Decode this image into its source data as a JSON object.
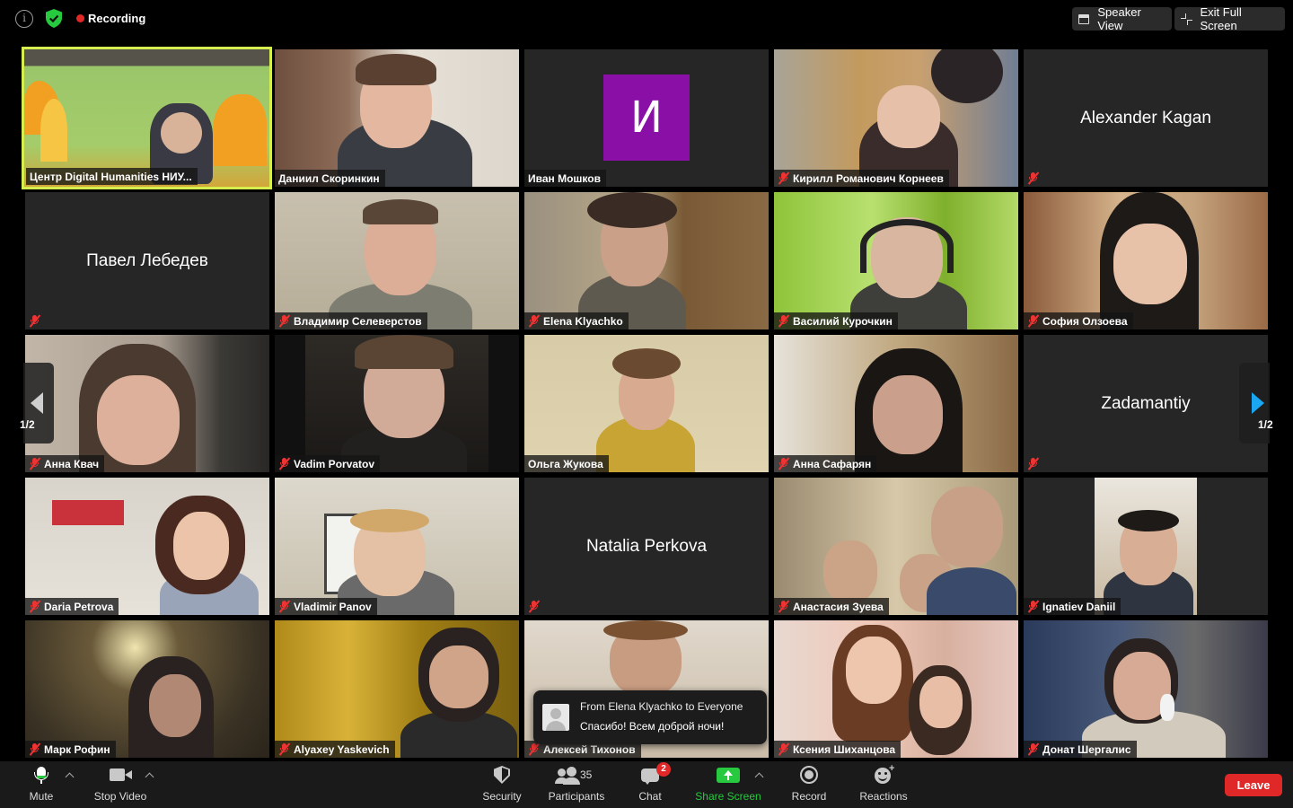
{
  "topbar": {
    "info_icon": "i",
    "recording_label": "Recording",
    "speaker_view_label": "Speaker View",
    "exit_full_screen_label": "Exit Full Screen"
  },
  "colors": {
    "active_speaker_border": "#d7ef4e",
    "muted_red": "#e33333",
    "share_green": "#27c93f",
    "leave_red": "#e02828",
    "avatar_purple": "#8a0fa6",
    "page_arrow_blue": "#1aa6f0"
  },
  "tiles": [
    {
      "name": "Центр Digital Humanities НИУ...",
      "type": "video",
      "muted": false,
      "active": true
    },
    {
      "name": "Даниил Скоринкин",
      "type": "video",
      "muted": false
    },
    {
      "name": "Иван Мошков",
      "type": "avatar",
      "initial": "И",
      "muted": false
    },
    {
      "name": "Кирилл Романович Корнеев",
      "type": "video",
      "muted": true
    },
    {
      "name": "Alexander Kagan",
      "type": "name",
      "muted": true
    },
    {
      "name": "Павел Лебедев",
      "type": "name",
      "muted": true
    },
    {
      "name": "Владимир Селеверстов",
      "type": "video",
      "muted": true
    },
    {
      "name": "Elena Klyachko",
      "type": "video",
      "muted": true
    },
    {
      "name": "Василий Курочкин",
      "type": "video",
      "muted": true
    },
    {
      "name": "София Олзоева",
      "type": "video",
      "muted": true
    },
    {
      "name": "Анна Квач",
      "type": "video",
      "muted": true
    },
    {
      "name": "Vadim Porvatov",
      "type": "video",
      "muted": true
    },
    {
      "name": "Ольга Жукова",
      "type": "video",
      "muted": false
    },
    {
      "name": "Анна Сафарян",
      "type": "video",
      "muted": true
    },
    {
      "name": "Zadamantiy",
      "type": "name",
      "muted": true
    },
    {
      "name": "Daria Petrova",
      "type": "video",
      "muted": true
    },
    {
      "name": "Vladimir Panov",
      "type": "video",
      "muted": true
    },
    {
      "name": "Natalia Perkova",
      "type": "name",
      "muted": true
    },
    {
      "name": "Анастасия Зуева",
      "type": "video",
      "muted": true
    },
    {
      "name": "Ignatiev Daniil",
      "type": "video",
      "muted": true
    },
    {
      "name": "Марк Рофин",
      "type": "video",
      "muted": true
    },
    {
      "name": "Alyaxey Yaskevich",
      "type": "video",
      "muted": true
    },
    {
      "name": "Алексей Тихонов",
      "type": "video",
      "muted": true
    },
    {
      "name": "Ксения Шиханцова",
      "type": "video",
      "muted": true
    },
    {
      "name": "Донат Шергалис",
      "type": "video",
      "muted": true
    }
  ],
  "pagination": {
    "left_label": "1/2",
    "right_label": "1/2"
  },
  "chat_toast": {
    "from": "From Elena Klyachko to Everyone",
    "message": "Спасибо! Всем доброй ночи!"
  },
  "toolbar": {
    "mute_label": "Mute",
    "stop_video_label": "Stop Video",
    "security_label": "Security",
    "participants_label": "Participants",
    "participants_count": "35",
    "chat_label": "Chat",
    "chat_badge": "2",
    "share_screen_label": "Share Screen",
    "record_label": "Record",
    "reactions_label": "Reactions",
    "leave_label": "Leave"
  },
  "icons": {
    "info": "info-icon",
    "security_shield": "shield-check-icon",
    "recording": "recording-dot-icon",
    "speaker_view": "speaker-view-icon",
    "exit_full_screen": "exit-fullscreen-icon",
    "muted": "muted-mic-icon",
    "mic": "microphone-icon",
    "video": "video-camera-icon",
    "security": "security-shield-icon",
    "participants": "participants-icon",
    "chat": "chat-bubble-icon",
    "share": "share-screen-icon",
    "record": "record-icon",
    "reactions": "reactions-emoji-icon"
  }
}
